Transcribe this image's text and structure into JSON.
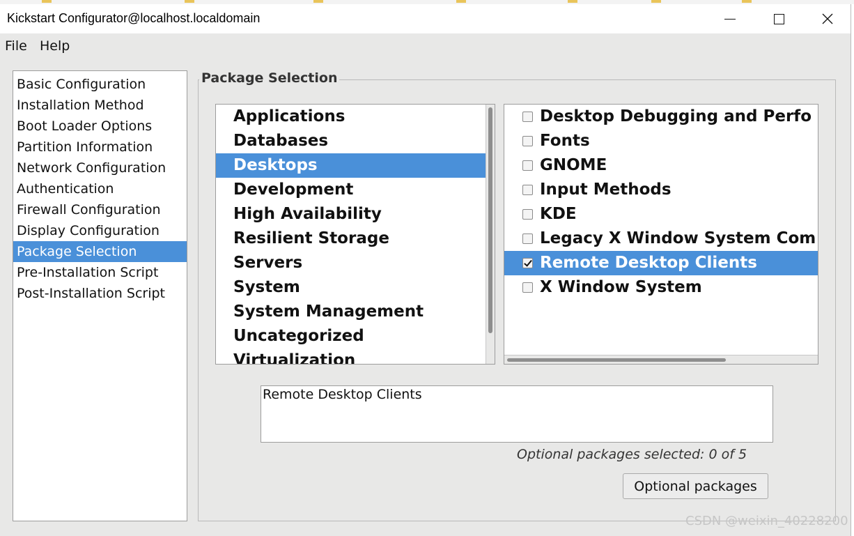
{
  "window": {
    "title": "Kickstart Configurator@localhost.localdomain",
    "controls": {
      "minimize_icon": "minimize-icon",
      "maximize_icon": "maximize-icon",
      "close_glyph": "✕"
    }
  },
  "menu": {
    "file": "File",
    "help": "Help"
  },
  "nav": {
    "items": [
      "Basic Configuration",
      "Installation Method",
      "Boot Loader Options",
      "Partition Information",
      "Network Configuration",
      "Authentication",
      "Firewall Configuration",
      "Display Configuration",
      "Package Selection",
      "Pre-Installation Script",
      "Post-Installation Script"
    ],
    "selected": "Package Selection"
  },
  "package_selection": {
    "title": "Package Selection",
    "groups": [
      "Applications",
      "Databases",
      "Desktops",
      "Development",
      "High Availability",
      "Resilient Storage",
      "Servers",
      "System",
      "System Management",
      "Uncategorized",
      "Virtualization"
    ],
    "selected_group": "Desktops",
    "packages": [
      {
        "label": "Desktop Debugging and Perfo",
        "checked": false
      },
      {
        "label": "Fonts",
        "checked": false
      },
      {
        "label": "GNOME",
        "checked": false
      },
      {
        "label": "Input Methods",
        "checked": false
      },
      {
        "label": "KDE",
        "checked": false
      },
      {
        "label": "Legacy X Window System Com",
        "checked": false
      },
      {
        "label": "Remote Desktop Clients",
        "checked": true,
        "selected": true
      },
      {
        "label": "X Window System",
        "checked": false
      }
    ],
    "description": "Remote Desktop Clients",
    "status": "Optional packages selected: 0 of 5",
    "optional_button": "Optional packages"
  },
  "watermark": "CSDN @weixin_40228200",
  "colors": {
    "selection": "#4a90d9",
    "window_bg": "#e8e8e7",
    "list_bg": "#ffffff"
  }
}
